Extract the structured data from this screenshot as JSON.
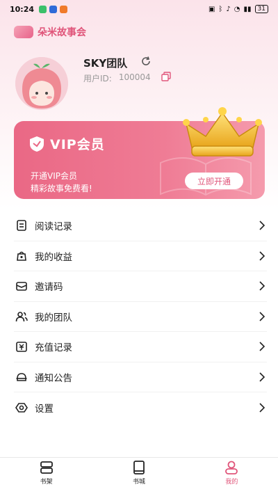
{
  "status": {
    "time": "10:24",
    "battery": "31",
    "app_icon_colors": [
      "#3cc06a",
      "#2f6ad8",
      "#f07a2a"
    ]
  },
  "app": {
    "brand_name": "朵米故事会",
    "accent": "#e0557a"
  },
  "profile": {
    "name": "SKY团队",
    "user_id_label": "用户ID:",
    "user_id": "100004"
  },
  "vip": {
    "title": "VIP会员",
    "line1": "开通VIP会员",
    "line2": "精彩故事免费看!",
    "button": "立即开通",
    "card_colors": [
      "#ea6885",
      "#f59bad"
    ]
  },
  "menu": [
    {
      "label": "阅读记录",
      "icon": "reading-record-icon"
    },
    {
      "label": "我的收益",
      "icon": "earnings-icon"
    },
    {
      "label": "邀请码",
      "icon": "invite-code-icon"
    },
    {
      "label": "我的团队",
      "icon": "team-icon"
    },
    {
      "label": "充值记录",
      "icon": "recharge-record-icon"
    },
    {
      "label": "通知公告",
      "icon": "notice-icon"
    },
    {
      "label": "设置",
      "icon": "settings-icon"
    }
  ],
  "tabs": [
    {
      "label": "书架",
      "icon": "bookshelf-icon",
      "active": false
    },
    {
      "label": "书城",
      "icon": "bookstore-icon",
      "active": false
    },
    {
      "label": "我的",
      "icon": "profile-icon",
      "active": true
    }
  ]
}
